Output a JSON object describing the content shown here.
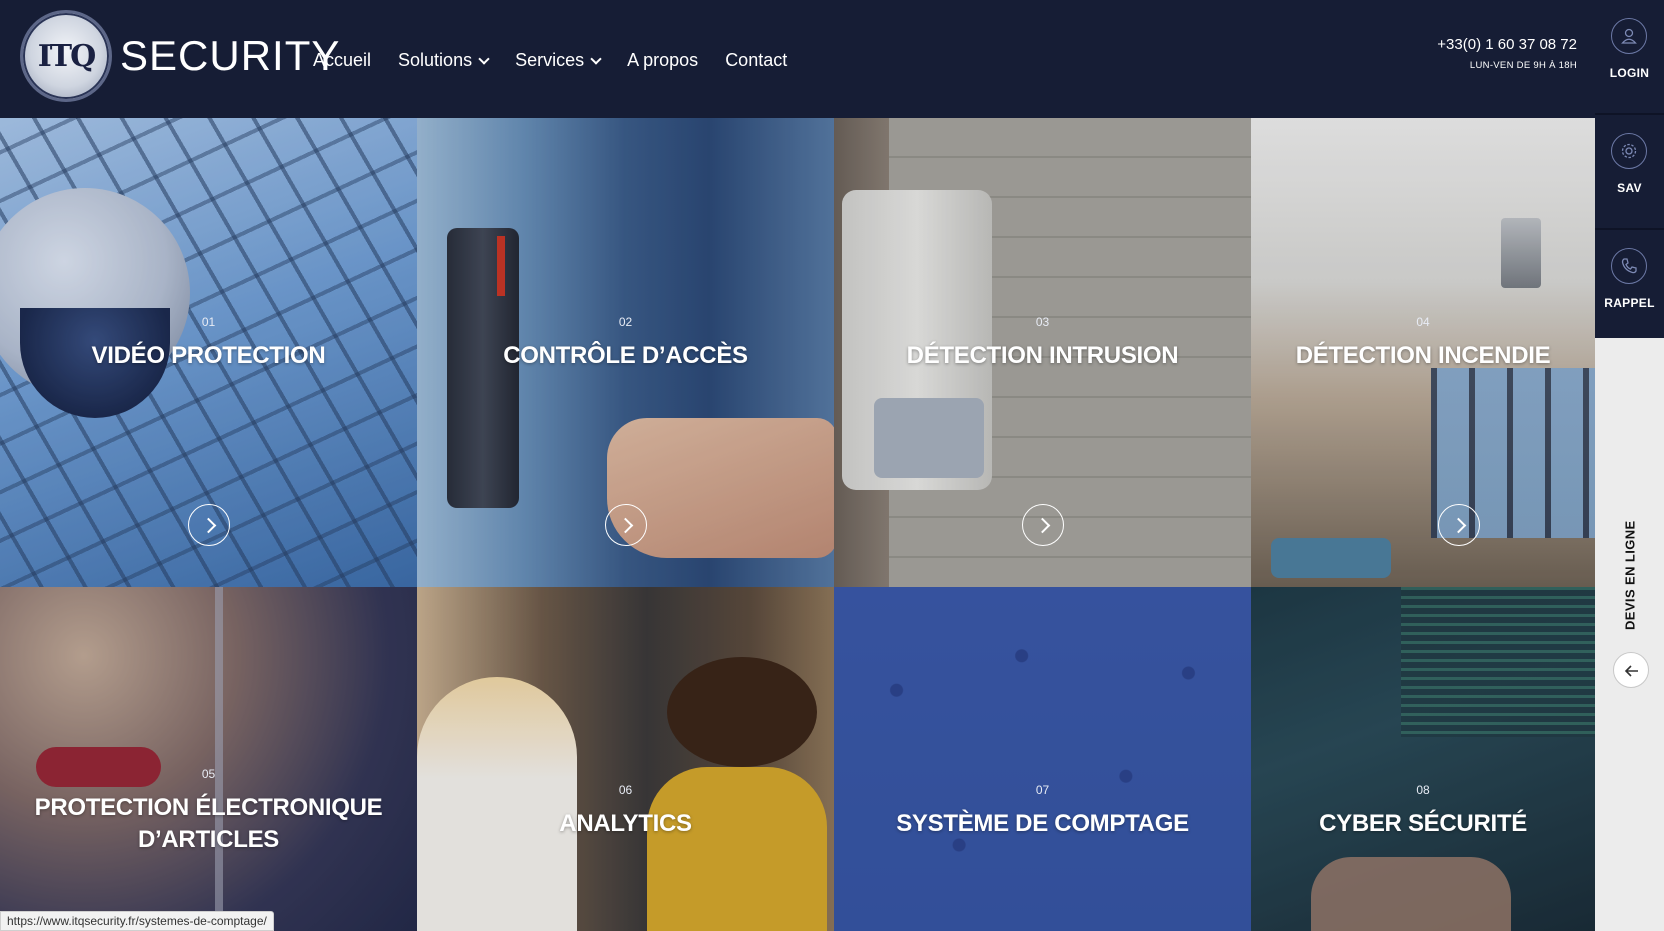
{
  "brand": {
    "logo_mark": "ITQ",
    "name": "SECURITY"
  },
  "nav": [
    {
      "label": "Accueil",
      "dropdown": false
    },
    {
      "label": "Solutions",
      "dropdown": true
    },
    {
      "label": "Services",
      "dropdown": true
    },
    {
      "label": "A propos",
      "dropdown": false
    },
    {
      "label": "Contact",
      "dropdown": false
    }
  ],
  "contact": {
    "phone": "+33(0) 1 60 37 08 72",
    "hours": "LUN-VEN DE 9H À 18H"
  },
  "sidebar": {
    "login": "LOGIN",
    "sav": "SAV",
    "rappel": "RAPPEL",
    "devis": "DEVIS EN LIGNE"
  },
  "tiles": [
    {
      "num": "01",
      "title": "VIDÉO PROTECTION"
    },
    {
      "num": "02",
      "title": "CONTRÔLE D’ACCÈS"
    },
    {
      "num": "03",
      "title": "DÉTECTION INTRUSION"
    },
    {
      "num": "04",
      "title": "DÉTECTION INCENDIE"
    },
    {
      "num": "05",
      "title_line1": "PROTECTION ÉLECTRONIQUE",
      "title_line2": "D’ARTICLES"
    },
    {
      "num": "06",
      "title": "ANALYTICS"
    },
    {
      "num": "07",
      "title": "SYSTÈME DE COMPTAGE"
    },
    {
      "num": "08",
      "title": "CYBER SÉCURITÉ"
    }
  ],
  "colors": {
    "navy": "#161d35",
    "sidebar_bg": "#ececec"
  },
  "status_url": "https://www.itqsecurity.fr/systemes-de-comptage/"
}
